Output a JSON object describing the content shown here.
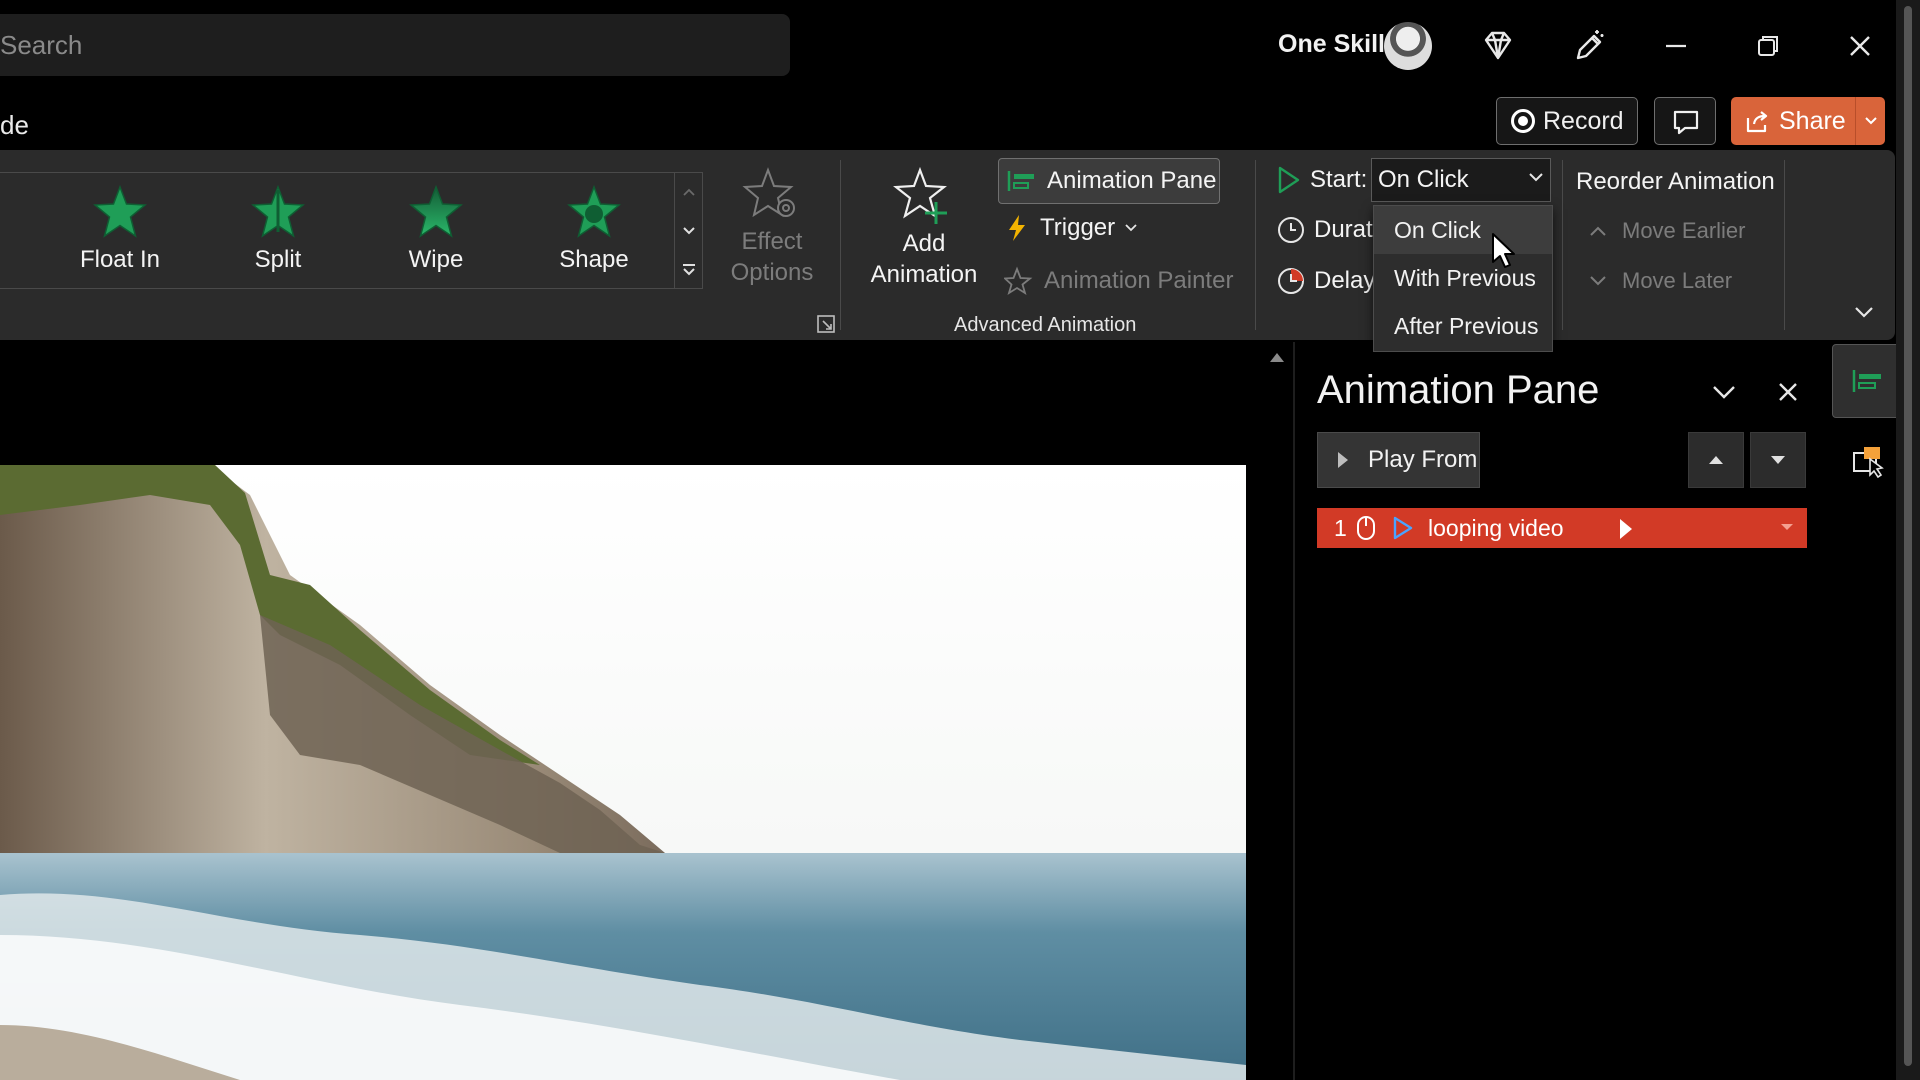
{
  "titlebar": {
    "search_placeholder": "Search",
    "user_name": "One Skill"
  },
  "command_row": {
    "tab_fragment": "de",
    "record_label": "Record",
    "share_label": "Share"
  },
  "ribbon": {
    "animations": [
      {
        "label": "Float In"
      },
      {
        "label": "Split"
      },
      {
        "label": "Wipe"
      },
      {
        "label": "Shape"
      }
    ],
    "effect_options": {
      "line1": "Effect",
      "line2": "Options"
    },
    "add_animation": {
      "line1": "Add",
      "line2": "Animation"
    },
    "animation_pane_label": "Animation Pane",
    "trigger_label": "Trigger",
    "animation_painter_label": "Animation Painter",
    "advanced_group_label": "Advanced Animation",
    "timing": {
      "start_label": "Start:",
      "start_value": "On Click",
      "duration_label": "Durati",
      "delay_label": "Delay:"
    },
    "reorder": {
      "title": "Reorder Animation",
      "move_earlier": "Move Earlier",
      "move_later": "Move Later"
    }
  },
  "start_menu": {
    "options": [
      "On Click",
      "With Previous",
      "After Previous"
    ],
    "hovered": "On Click"
  },
  "animation_pane": {
    "title": "Animation Pane",
    "play_from_label": "Play From",
    "items": [
      {
        "number": "1",
        "label": "looping video"
      }
    ]
  },
  "colors": {
    "accent_green": "#1f9e57",
    "share_orange": "#d9643a",
    "selected_row_red": "#d23a26",
    "ribbon_bg": "#2b2b2b"
  }
}
